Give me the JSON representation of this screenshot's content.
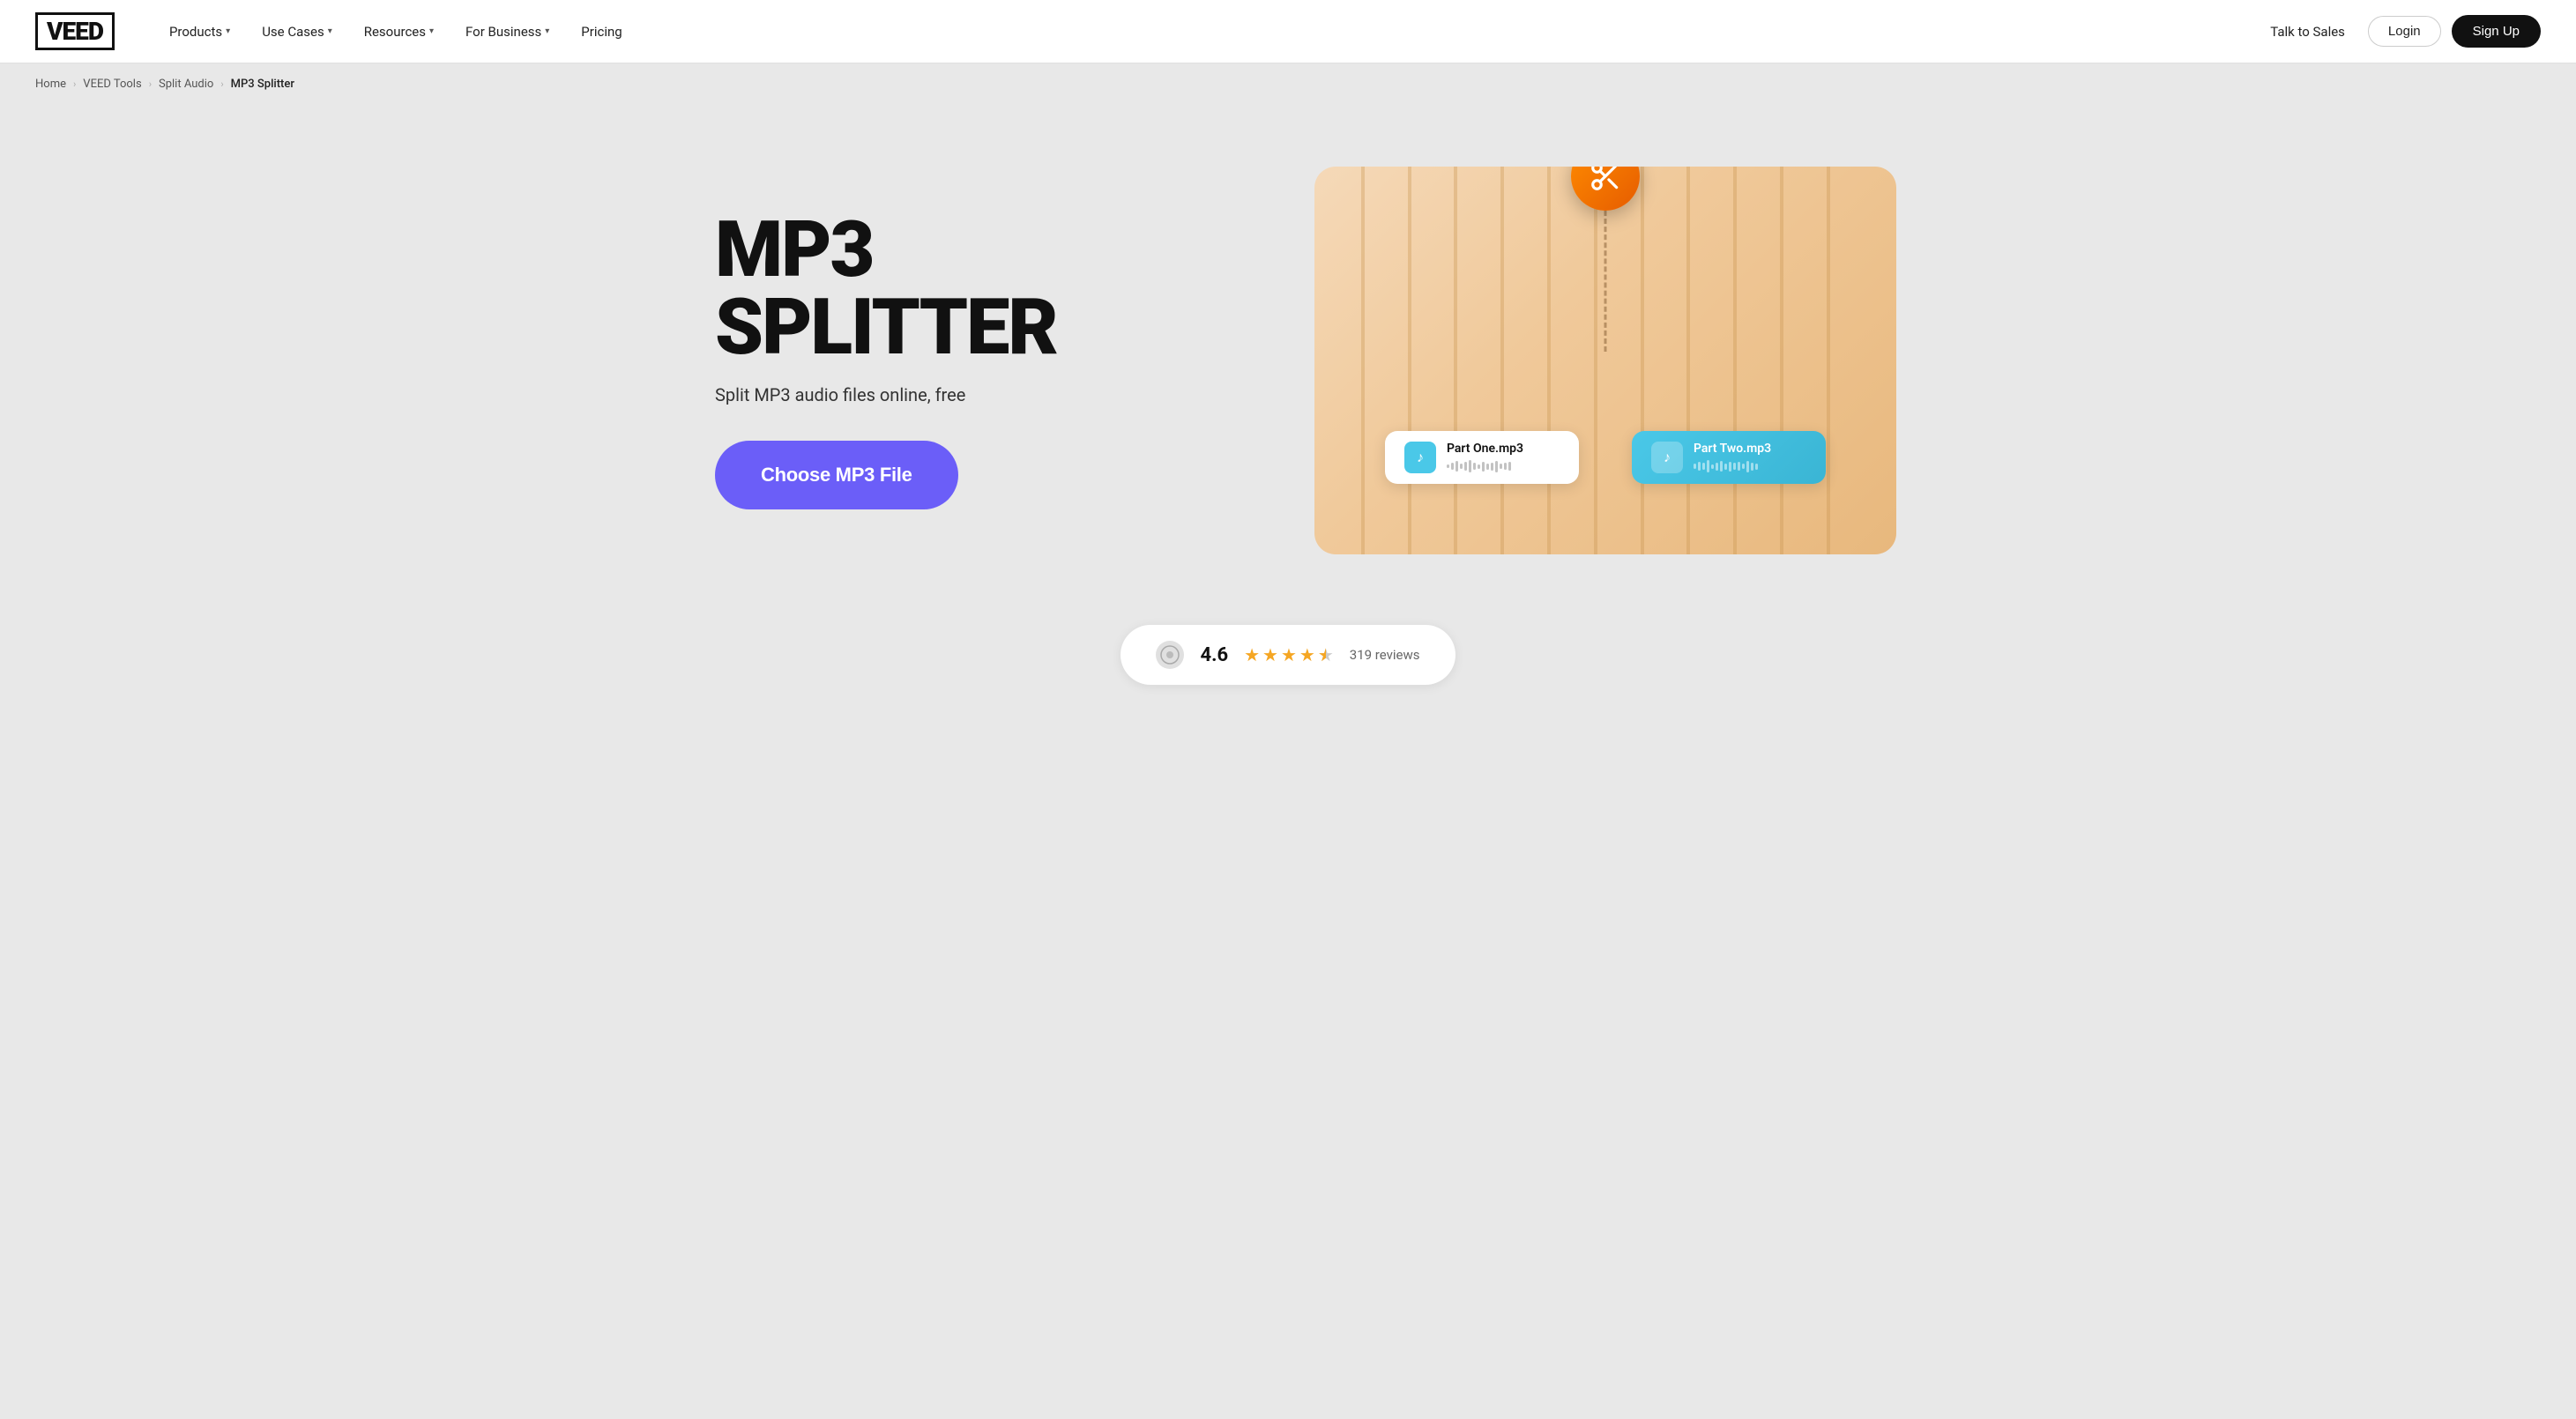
{
  "nav": {
    "logo": "VEED",
    "links": [
      {
        "label": "Products",
        "has_dropdown": true
      },
      {
        "label": "Use Cases",
        "has_dropdown": true
      },
      {
        "label": "Resources",
        "has_dropdown": true
      },
      {
        "label": "For Business",
        "has_dropdown": true
      },
      {
        "label": "Pricing",
        "has_dropdown": false
      }
    ],
    "talk_to_sales": "Talk to Sales",
    "login": "Login",
    "signup": "Sign Up"
  },
  "breadcrumb": {
    "items": [
      {
        "label": "Home",
        "active": false
      },
      {
        "label": "VEED Tools",
        "active": false
      },
      {
        "label": "Split Audio",
        "active": false
      },
      {
        "label": "MP3 Splitter",
        "active": true
      }
    ]
  },
  "hero": {
    "title": "MP3 SPLITTER",
    "subtitle": "Split MP3 audio files online, free",
    "cta_label": "Choose MP3 File",
    "illustration": {
      "scissors_icon": "✂",
      "card_one": {
        "name": "Part One.mp3",
        "icon": "♪",
        "waveform_bars": [
          4,
          8,
          12,
          6,
          10,
          14,
          8,
          5,
          11,
          7,
          9,
          13,
          6,
          8,
          10
        ]
      },
      "card_two": {
        "name": "Part Two.mp3",
        "icon": "♪",
        "waveform_bars": [
          6,
          10,
          8,
          14,
          5,
          9,
          12,
          7,
          11,
          8,
          10,
          6,
          13,
          9,
          7
        ]
      }
    }
  },
  "rating": {
    "score": "4.6",
    "stars": [
      1,
      1,
      1,
      1,
      0.5
    ],
    "count": "319 reviews",
    "logo_icon": "⊙"
  }
}
